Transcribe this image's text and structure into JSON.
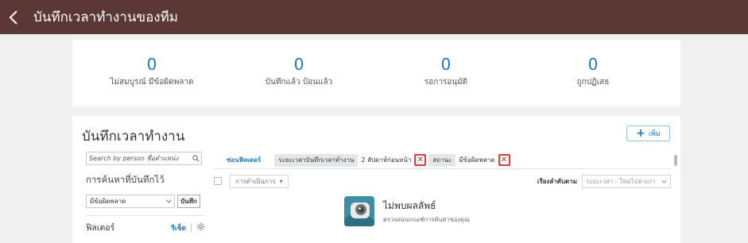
{
  "header": {
    "title": "บันทึกเวลาทำงานของทีม"
  },
  "summary": [
    {
      "value": "0",
      "label": "ไม่สมบูรณ์ มีข้อผิดพลาด"
    },
    {
      "value": "0",
      "label": "บันทึกแล้ว ป้อนแล้ว"
    },
    {
      "value": "0",
      "label": "รอการอนุมัติ"
    },
    {
      "value": "0",
      "label": "ถูกปฏิเสธ"
    }
  ],
  "section": {
    "title": "บันทึกเวลาทำงาน",
    "add_label": "เพิ่ม"
  },
  "left_panel": {
    "search_placeholder": "Search by person ชื่อตำแหน่ง",
    "saved_searches_label": "การค้นหาที่บันทึกไว้",
    "saved_select_value": "มีข้อผิดพลาด",
    "save_button": "บันทึก",
    "filters_label": "ฟิลเตอร์",
    "reset_label": "รีเซ็ต"
  },
  "filter_bar": {
    "hide_filters": "ซ่อนฟิลเตอร์",
    "chips": [
      {
        "key": "ระยะเวลาบันทึกเวลาทำงาน",
        "value": "2 สัปดาห์ก่อนหน้า"
      },
      {
        "key": "สถานะ",
        "value": "มีข้อผิดพลาด"
      }
    ]
  },
  "action_bar": {
    "actions_label": "การดำเนินการ",
    "sort_label": "เรียงลำดับตาม",
    "sort_value": "ระยะเวลา - ใหม่ไปหาเก่า"
  },
  "empty_state": {
    "title": "ไม่พบผลลัพธ์",
    "subtitle": "ตรวจสอบเกณฑ์การค้นหาของคุณ"
  },
  "colors": {
    "header_bg": "#5b3836",
    "accent": "#1e7bc2",
    "highlight": "#e53935"
  }
}
